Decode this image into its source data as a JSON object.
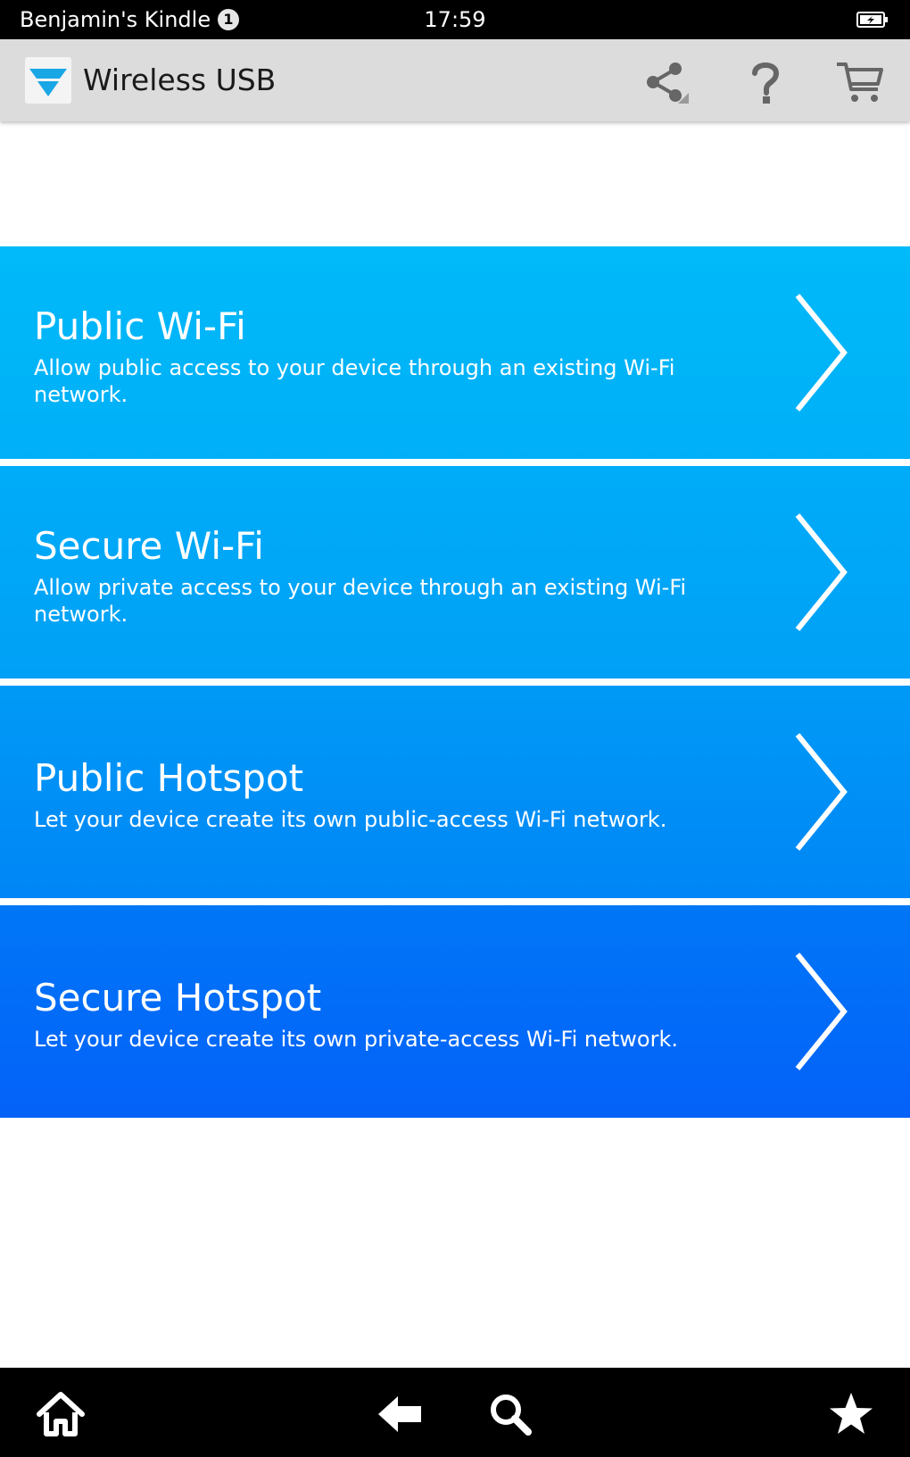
{
  "status_bar": {
    "device_name": "Benjamin's Kindle",
    "notification_count": "1",
    "time": "17:59",
    "icons": [
      "notification-badge",
      "battery-icon"
    ]
  },
  "app_bar": {
    "title": "Wireless USB",
    "icons": [
      "wireless-usb-logo",
      "share-icon",
      "help-icon",
      "cart-icon"
    ]
  },
  "options": [
    {
      "title": "Public Wi-Fi",
      "description": "Allow public access to your device through an existing Wi-Fi network.",
      "color": "#00b4f8"
    },
    {
      "title": "Secure Wi-Fi",
      "description": "Allow private access to your device through an existing Wi-Fi network.",
      "color": "#00a6f7"
    },
    {
      "title": "Public Hotspot",
      "description": "Let your device create its own public-access Wi-Fi network.",
      "color": "#0090f6"
    },
    {
      "title": "Secure Hotspot",
      "description": "Let your device create its own private-access Wi-Fi network.",
      "color": "#066cf8"
    }
  ],
  "nav_bar": {
    "icons": [
      "home-icon",
      "back-arrow-icon",
      "search-icon",
      "star-icon"
    ]
  },
  "colors": {
    "status_bar_bg": "#000000",
    "app_bar_bg": "#dcdcdc",
    "logo_blue": "#19a7e6",
    "nav_bar_bg": "#000000"
  }
}
